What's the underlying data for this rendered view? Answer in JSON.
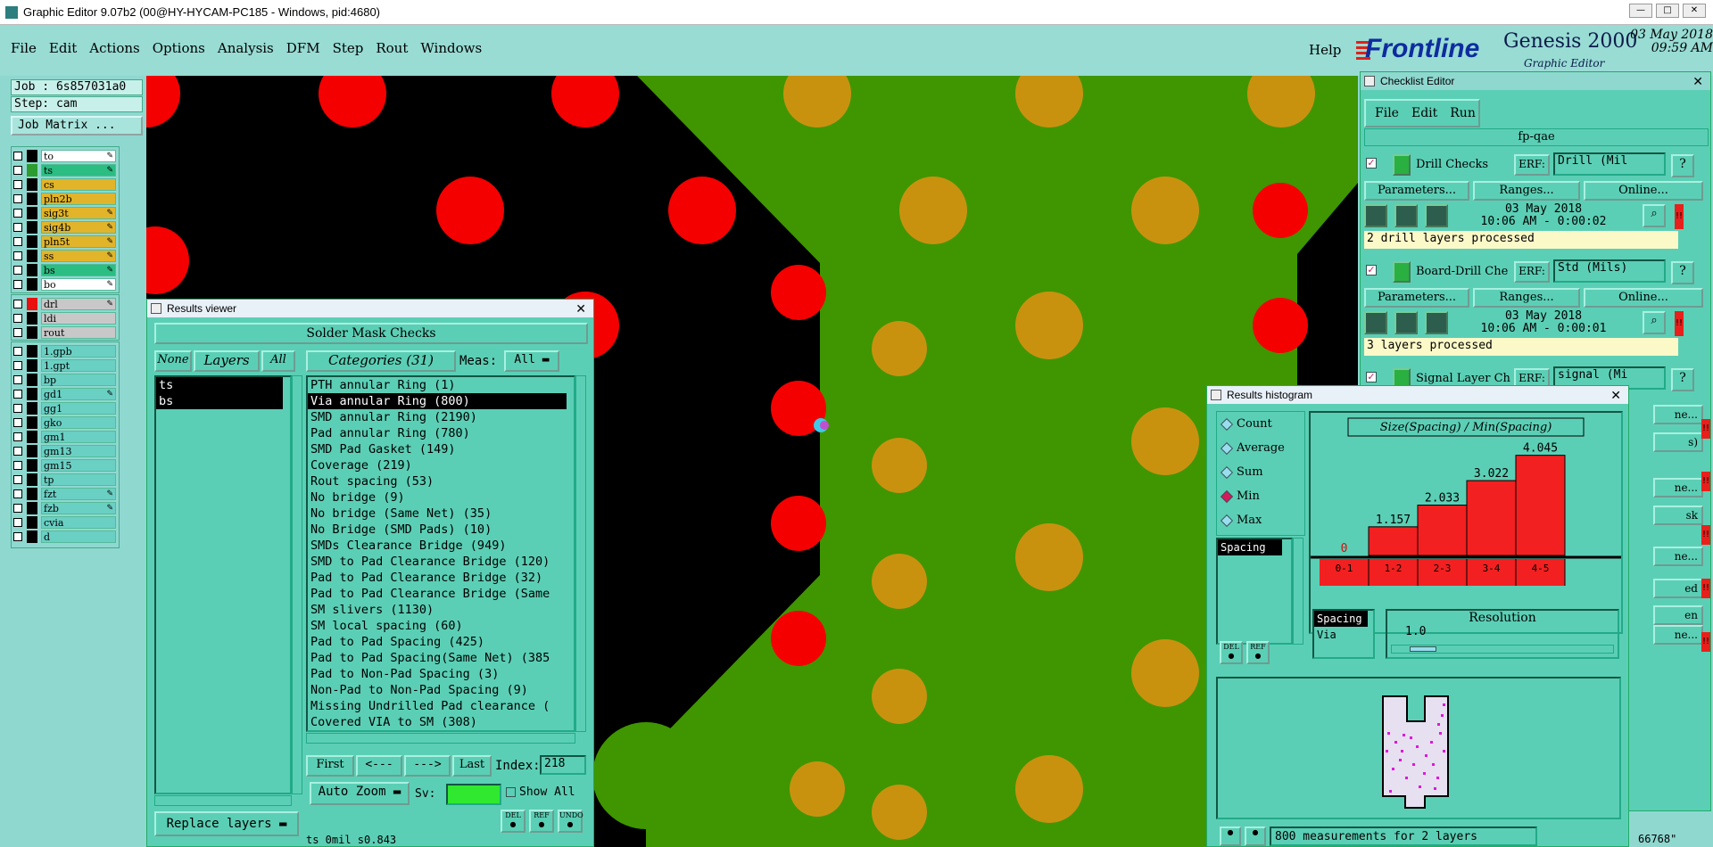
{
  "window": {
    "title": "Graphic Editor 9.07b2 (00@HY-HYCAM-PC185 - Windows, pid:4680)"
  },
  "menu": [
    "File",
    "Edit",
    "Actions",
    "Options",
    "Analysis",
    "DFM",
    "Step",
    "Rout",
    "Windows"
  ],
  "help": "Help",
  "brand": {
    "name": "Frontline",
    "product": "Genesis 2000",
    "sub": "Graphic Editor",
    "date": "03 May 2018",
    "time": "09:59 AM"
  },
  "left": {
    "job": "Job : 6s857031a0",
    "step": "Step: cam",
    "job_matrix": "Job Matrix ...",
    "layers1": [
      {
        "name": "to",
        "color": "#ffffff",
        "arrow": true
      },
      {
        "name": "ts",
        "color": "#2bbd82",
        "arrow": true,
        "swatch": "#2c9c30"
      },
      {
        "name": "cs",
        "color": "#e2b42a"
      },
      {
        "name": "pln2b",
        "color": "#e2b42a"
      },
      {
        "name": "sig3t",
        "color": "#e2b42a",
        "arrow": true
      },
      {
        "name": "sig4b",
        "color": "#e2b42a",
        "arrow": true
      },
      {
        "name": "pln5t",
        "color": "#e2b42a",
        "arrow": true
      },
      {
        "name": "ss",
        "color": "#e2b42a",
        "arrow": true
      },
      {
        "name": "bs",
        "color": "#2bbd82",
        "arrow": true
      },
      {
        "name": "bo",
        "color": "#ffffff",
        "arrow": true
      }
    ],
    "layers2": [
      {
        "name": "drl",
        "color": "#c8c8c8",
        "swatch": "#e81010",
        "arrow": true
      },
      {
        "name": "ldi",
        "color": "#c8c8c8"
      },
      {
        "name": "rout",
        "color": "#c8c8c8"
      }
    ],
    "layers3": [
      {
        "name": "1.gpb",
        "color": "#6ad0c4"
      },
      {
        "name": "1.gpt",
        "color": "#6ad0c4"
      },
      {
        "name": "bp",
        "color": "#6ad0c4"
      },
      {
        "name": "gd1",
        "color": "#6ad0c4",
        "arrow": true
      },
      {
        "name": "gg1",
        "color": "#6ad0c4"
      },
      {
        "name": "gko",
        "color": "#6ad0c4"
      },
      {
        "name": "gm1",
        "color": "#6ad0c4"
      },
      {
        "name": "gm13",
        "color": "#6ad0c4"
      },
      {
        "name": "gm15",
        "color": "#6ad0c4"
      },
      {
        "name": "tp",
        "color": "#6ad0c4"
      },
      {
        "name": "fzt",
        "color": "#6ad0c4",
        "arrow": true
      },
      {
        "name": "fzb",
        "color": "#6ad0c4",
        "arrow": true
      },
      {
        "name": "cvia",
        "color": "#6ad0c4"
      },
      {
        "name": "d",
        "color": "#6ad0c4"
      }
    ]
  },
  "results": {
    "title": "Results viewer",
    "header": "Solder Mask Checks",
    "none": "None",
    "layers": "Layers",
    "all": "All",
    "categories": "Categories (31)",
    "meas_label": "Meas:",
    "meas_value": "All",
    "layer_items": [
      "ts",
      "bs"
    ],
    "items": [
      "PTH annular Ring (1)",
      "Via annular Ring (800)",
      "SMD annular Ring (2190)",
      "Pad annular Ring (780)",
      "SMD Pad Gasket (149)",
      "Coverage (219)",
      "Rout spacing (53)",
      "No bridge (9)",
      "No bridge (Same Net) (35)",
      "No Bridge (SMD Pads) (10)",
      "SMDs Clearance Bridge (949)",
      "SMD to Pad Clearance Bridge (120)",
      "Pad to Pad Clearance Bridge (32)",
      "Pad to Pad Clearance Bridge (Same",
      "SM slivers (1130)",
      "SM local spacing (60)",
      "Pad to Pad Spacing (425)",
      "Pad to Pad Spacing(Same Net) (385",
      "Pad to Non-Pad Spacing (3)",
      "Non-Pad to Non-Pad Spacing (9)",
      "Missing Undrilled Pad clearance (",
      "Covered VIA to SM (308)"
    ],
    "selected": 1,
    "first": "First",
    "prev": "<---",
    "next": "--->",
    "last": "Last",
    "index_label": "Index:",
    "index_value": "218",
    "auto_zoom": "Auto Zoom",
    "sv": "Sv:",
    "show_all": "Show All",
    "replace": "Replace layers",
    "del": "DEL",
    "ref": "REF",
    "undo": "UNDO",
    "status": "ts 0mil  s0.843"
  },
  "checklist": {
    "title": "Checklist Editor",
    "menu": [
      "File",
      "Edit",
      "Run"
    ],
    "name": "fp-qae",
    "checks": [
      {
        "name": "Drill Checks",
        "erf": "Drill (Mil",
        "params": "Parameters...",
        "ranges": "Ranges...",
        "online": "Online...",
        "date": "03 May 2018",
        "time": "10:06 AM - 0:00:02",
        "msg": "2 drill layers processed"
      },
      {
        "name": "Board-Drill Che",
        "erf": "Std (Mils)",
        "params": "Parameters...",
        "ranges": "Ranges...",
        "online": "Online...",
        "date": "03 May 2018",
        "time": "10:06 AM - 0:00:01",
        "msg": "3 layers processed"
      },
      {
        "name": "Signal Layer Ch",
        "erf": "signal (Mi"
      }
    ],
    "erf_label": "ERF:",
    "side_frags": [
      "ne...",
      "s)",
      "ne...",
      "sk",
      "ne...",
      "ed",
      "en",
      "ne..."
    ]
  },
  "histogram": {
    "title": "Results histogram",
    "modes": [
      "Count",
      "Average",
      "Sum",
      "Min",
      "Max"
    ],
    "selected_mode": 3,
    "chart_title": "Size(Spacing) / Min(Spacing)",
    "measure_list": [
      "Spacing"
    ],
    "measure_list2": [
      "Spacing",
      "Via"
    ],
    "resolution_label": "Resolution",
    "resolution": "1.0",
    "status": "800 measurements for 2 layers",
    "coord": "66768\"",
    "del": "DEL",
    "ref": "REF"
  },
  "chart_data": {
    "type": "bar",
    "categories": [
      "0-1",
      "1-2",
      "2-3",
      "3-4",
      "4-5"
    ],
    "values": [
      0,
      1.157,
      2.033,
      3.022,
      4.045
    ],
    "labels": [
      "0",
      "1.157",
      "2.033",
      "3.022",
      "4.045"
    ],
    "title": "Size(Spacing) / Min(Spacing)",
    "ylim": [
      0,
      4.5
    ],
    "bar_color": "#f22020"
  }
}
